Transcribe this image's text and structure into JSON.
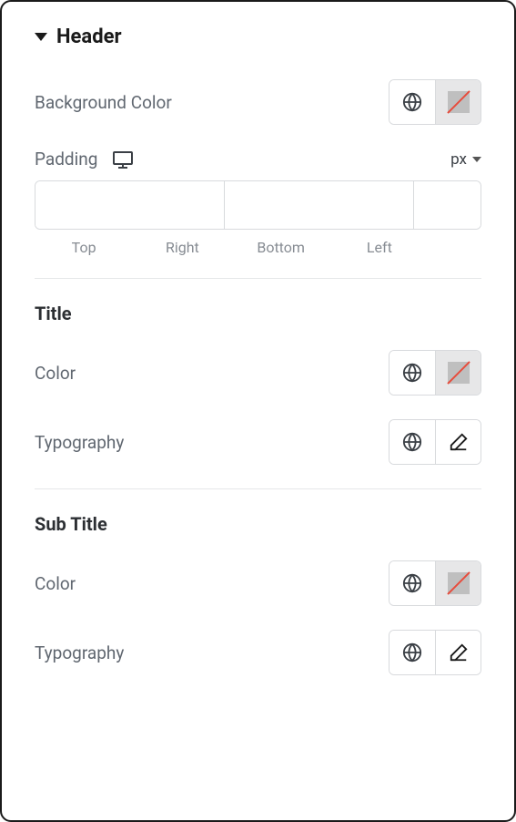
{
  "header": {
    "title": "Header"
  },
  "background": {
    "label": "Background Color"
  },
  "padding": {
    "label": "Padding",
    "unit": "px",
    "top": "",
    "right": "",
    "bottom": "",
    "left": "",
    "labels": {
      "top": "Top",
      "right": "Right",
      "bottom": "Bottom",
      "left": "Left"
    }
  },
  "title_section": {
    "heading": "Title",
    "color_label": "Color",
    "typography_label": "Typography"
  },
  "subtitle_section": {
    "heading": "Sub Title",
    "color_label": "Color",
    "typography_label": "Typography"
  }
}
